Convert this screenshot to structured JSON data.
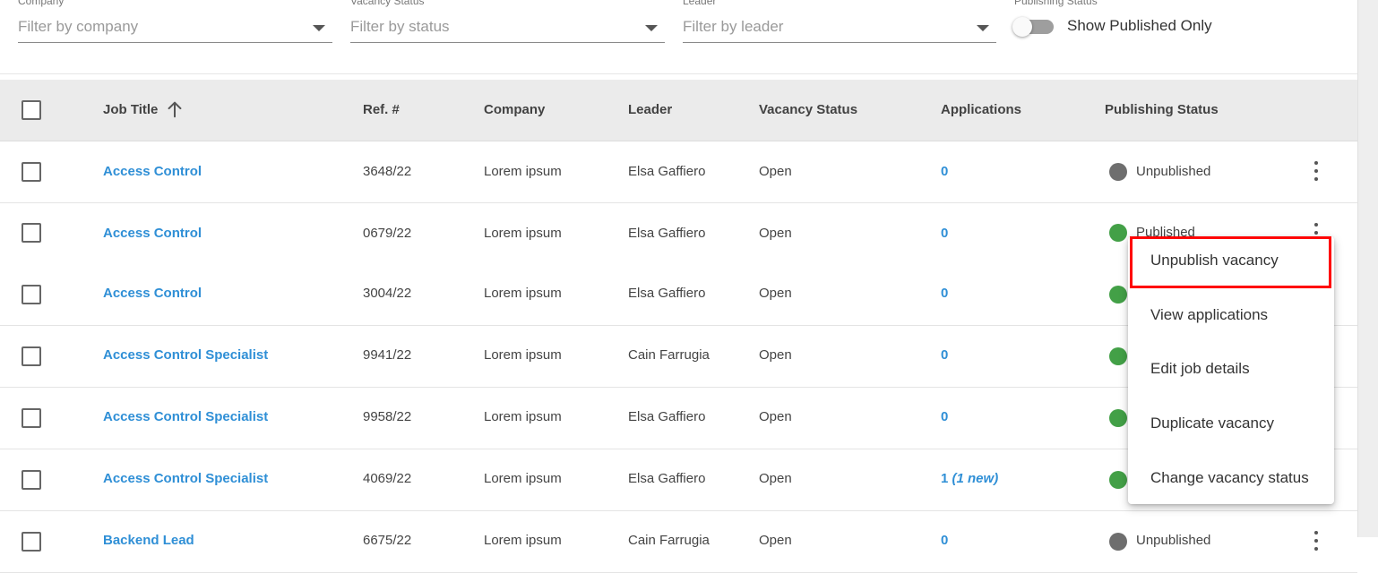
{
  "filters": [
    {
      "label": "Company",
      "placeholder": "Filter by company"
    },
    {
      "label": "Vacancy Status",
      "placeholder": "Filter by status"
    },
    {
      "label": "Leader",
      "placeholder": "Filter by leader"
    }
  ],
  "publishing_filter": {
    "label": "Publishing Status",
    "toggle_label": "Show Published Only",
    "checked": false
  },
  "table": {
    "headers": [
      "Job Title",
      "Ref. #",
      "Company",
      "Leader",
      "Vacancy Status",
      "Applications",
      "Publishing Status"
    ],
    "sort": {
      "column": "Job Title",
      "direction": "ascending"
    },
    "rows": [
      {
        "title": "Access Control",
        "ref": "3648/22",
        "company": "Lorem ipsum",
        "leader": "Elsa Gaffiero",
        "status": "Open",
        "applications": "0",
        "applications_new": "",
        "publishing": "Unpublished",
        "publishing_color": "#6e6e6e"
      },
      {
        "title": "Access Control",
        "ref": "0679/22",
        "company": "Lorem ipsum",
        "leader": "Elsa Gaffiero",
        "status": "Open",
        "applications": "0",
        "applications_new": "",
        "publishing": "Published",
        "publishing_color": "#43a047"
      },
      {
        "title": "Access Control",
        "ref": "3004/22",
        "company": "Lorem ipsum",
        "leader": "Elsa Gaffiero",
        "status": "Open",
        "applications": "0",
        "applications_new": "",
        "publishing": "",
        "publishing_color": "#43a047"
      },
      {
        "title": "Access Control Specialist",
        "ref": "9941/22",
        "company": "Lorem ipsum",
        "leader": "Cain Farrugia",
        "status": "Open",
        "applications": "0",
        "applications_new": "",
        "publishing": "",
        "publishing_color": "#43a047"
      },
      {
        "title": "Access Control Specialist",
        "ref": "9958/22",
        "company": "Lorem ipsum",
        "leader": "Elsa Gaffiero",
        "status": "Open",
        "applications": "0",
        "applications_new": "",
        "publishing": "",
        "publishing_color": "#43a047"
      },
      {
        "title": "Access Control Specialist",
        "ref": "4069/22",
        "company": "Lorem ipsum",
        "leader": "Elsa Gaffiero",
        "status": "Open",
        "applications": "1",
        "applications_new": "(1 new)",
        "publishing": "",
        "publishing_color": "#43a047"
      },
      {
        "title": "Backend Lead",
        "ref": "6675/22",
        "company": "Lorem ipsum",
        "leader": "Cain Farrugia",
        "status": "Open",
        "applications": "0",
        "applications_new": "",
        "publishing": "Unpublished",
        "publishing_color": "#6e6e6e"
      }
    ]
  },
  "row_menu": {
    "items": [
      "Unpublish vacancy",
      "View applications",
      "Edit job details",
      "Duplicate vacancy",
      "Change vacancy status"
    ],
    "highlighted": "Unpublish vacancy"
  },
  "colors": {
    "link": "#2f8fd6",
    "published": "#43a047",
    "unpublished": "#6e6e6e",
    "highlight": "#ff0000",
    "header_bg": "#ebebeb"
  }
}
